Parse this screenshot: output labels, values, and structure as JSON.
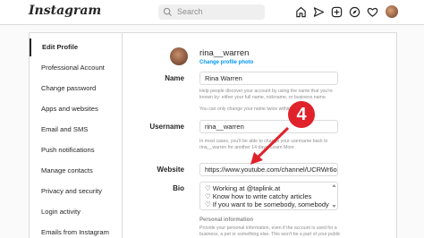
{
  "header": {
    "logo": "Instagram",
    "search_placeholder": "Search"
  },
  "sidebar": {
    "items": [
      {
        "label": "Edit Profile"
      },
      {
        "label": "Professional Account"
      },
      {
        "label": "Change password"
      },
      {
        "label": "Apps and websites"
      },
      {
        "label": "Email and SMS"
      },
      {
        "label": "Push notifications"
      },
      {
        "label": "Manage contacts"
      },
      {
        "label": "Privacy and security"
      },
      {
        "label": "Login activity"
      },
      {
        "label": "Emails from Instagram"
      }
    ]
  },
  "profile": {
    "username": "rina__warren",
    "change_photo": "Change profile photo"
  },
  "form": {
    "name_label": "Name",
    "name_value": "Rina Warren",
    "name_help": "Help people discover your account by using the name that you're known by: either your full name, nickname, or business name.",
    "name_help2": "You can only change your name twice within 14 days.",
    "username_label": "Username",
    "username_value": "rina__warren",
    "username_help": "In most cases, you'll be able to change your username back to rina__warren for another 14 days. Learn More",
    "website_label": "Website",
    "website_value": "https://www.youtube.com/channel/UCRWr6oJX",
    "bio_label": "Bio",
    "bio_lines": [
      "♡ Working at @taplink.at",
      "♡ Know how to write catchy articles",
      "♡ If you want to be somebody, somebody"
    ],
    "personal_info_title": "Personal information",
    "personal_info_help": "Provide your personal information, even if the account is used for a business, a pet or something else. This won't be a part of your public profile."
  },
  "annotation": {
    "step_number": "4",
    "color": "#e0222b"
  }
}
